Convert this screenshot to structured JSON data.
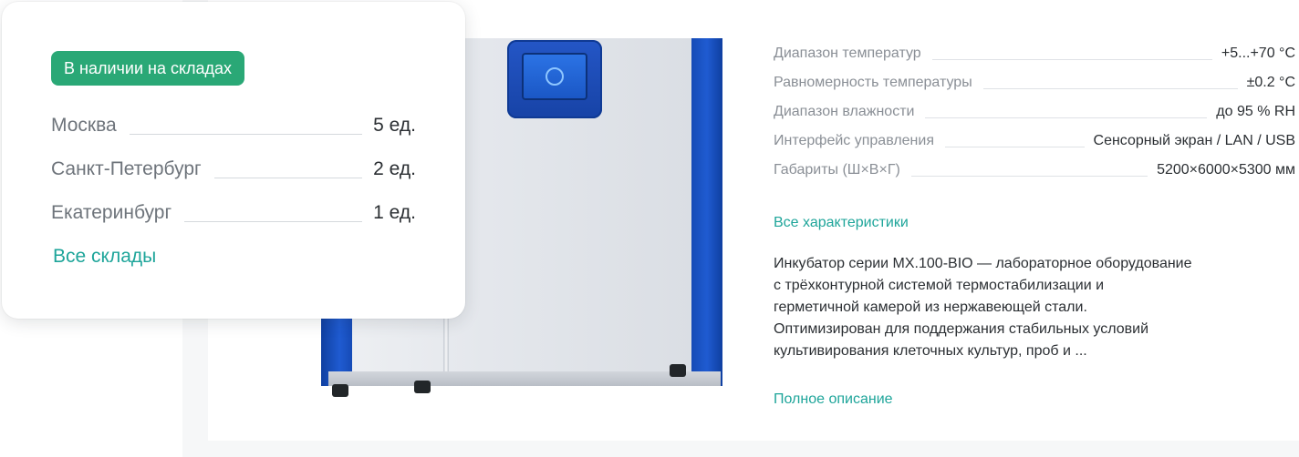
{
  "stock_popup": {
    "badge": "В наличии на складах",
    "warehouses": [
      {
        "city": "Москва",
        "qty": "5 ед."
      },
      {
        "city": "Санкт-Петербург",
        "qty": "2 ед."
      },
      {
        "city": "Екатеринбург",
        "qty": "1 ед."
      }
    ],
    "all_link": "Все склады"
  },
  "specs": [
    {
      "label": "Диапазон температур",
      "value": "+5...+70 °C"
    },
    {
      "label": "Равномерность температуры",
      "value": "±0.2 °C"
    },
    {
      "label": "Диапазон влажности",
      "value": "до 95 % RH"
    },
    {
      "label": "Интерфейс управления",
      "value": "Сенсорный экран / LAN / USB"
    },
    {
      "label": "Габариты (Ш×В×Г)",
      "value": "5200×6000×5300 мм"
    }
  ],
  "all_specs_link": "Все характеристики",
  "description": "Инкубатор серии MX.100-BIO — лабораторное оборудование\nс трёхконтурной системой термостабилизации и\nгерметичной камерой из нержавеющей стали.\nОптимизирован для поддержания стабильных условий\nкультивирования клеточных культур, проб и ...",
  "full_description_link": "Полное описание",
  "colors": {
    "accent": "#1ea59a",
    "badge": "#2aa876",
    "incubator_blue": "#1f5bd1"
  }
}
